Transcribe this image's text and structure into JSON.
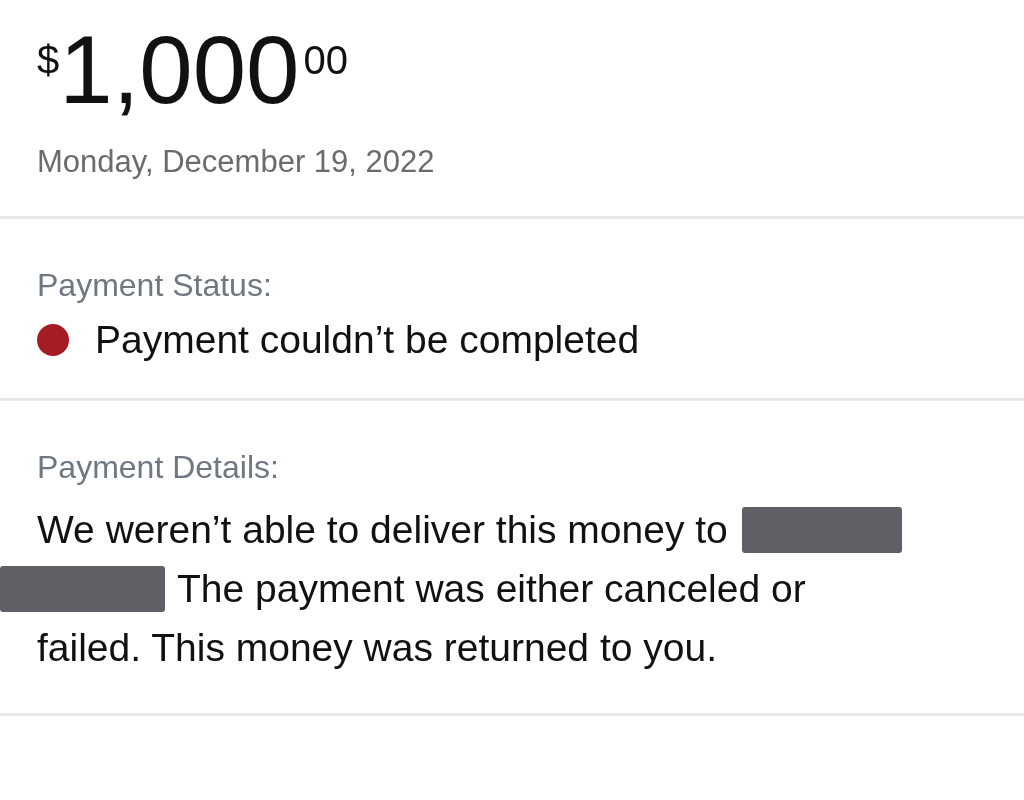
{
  "amount": {
    "currency": "$",
    "whole": "1,000",
    "cents": "00"
  },
  "date": "Monday, December 19, 2022",
  "status": {
    "label": "Payment Status:",
    "text": "Payment couldn’t be completed",
    "color": "#a51c24"
  },
  "details": {
    "label": "Payment Details:",
    "lines": [
      [
        {
          "kind": "text",
          "text": "We weren’t able to deliver this money to"
        },
        {
          "kind": "redacted"
        }
      ],
      [
        {
          "kind": "redacted"
        },
        {
          "kind": "text",
          "text": "The payment was either canceled or"
        }
      ],
      [
        {
          "kind": "text",
          "text": "failed. This money was returned to you."
        }
      ]
    ]
  }
}
